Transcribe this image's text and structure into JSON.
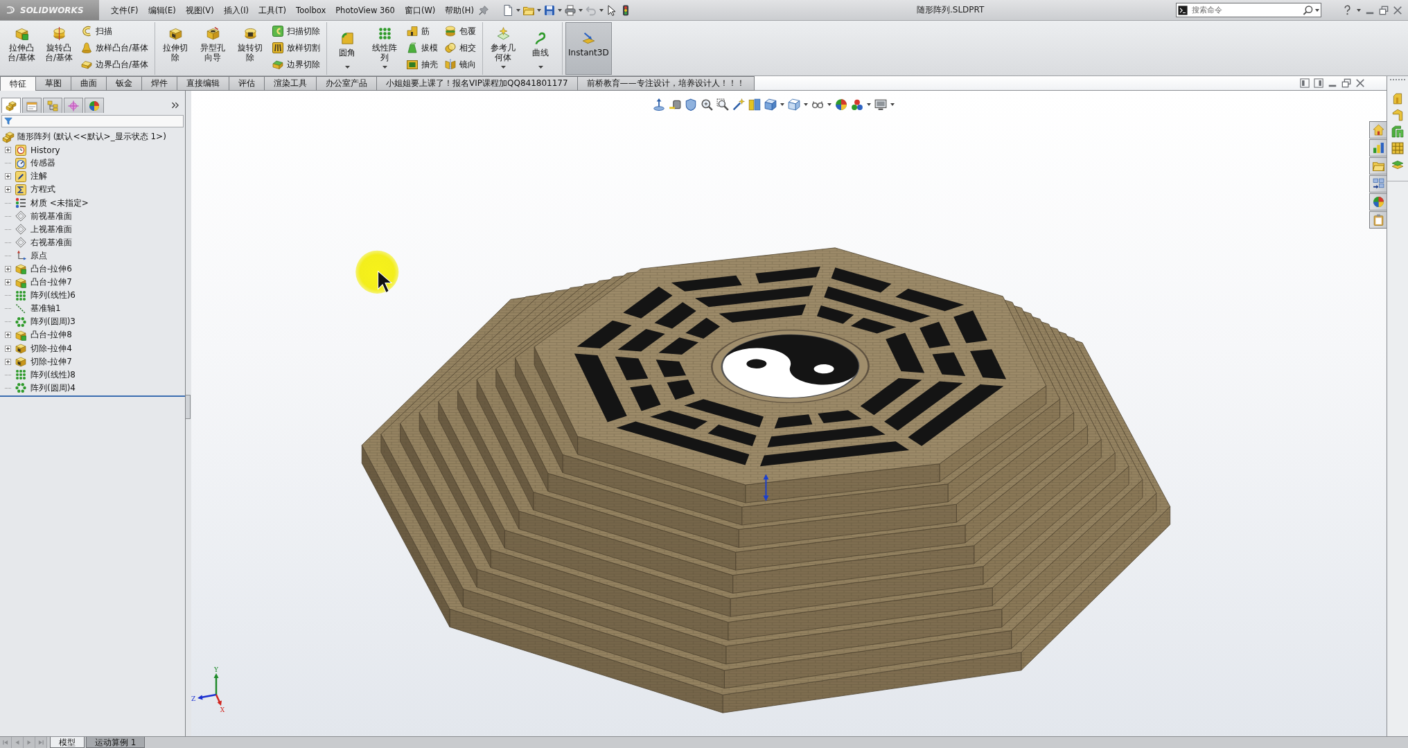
{
  "menu_bar": {
    "logo": "SOLIDWORKS",
    "menu": [
      "文件(F)",
      "编辑(E)",
      "视图(V)",
      "插入(I)",
      "工具(T)",
      "Toolbox",
      "PhotoView 360",
      "窗口(W)",
      "帮助(H)"
    ],
    "document_title": "随形阵列.SLDPRT",
    "search": {
      "placeholder": "搜索命令"
    }
  },
  "ribbon": [
    {
      "buttons": [
        {
          "kind": "large",
          "label": "拉伸凸台/基体",
          "has_menu": false,
          "on": false
        },
        {
          "kind": "large",
          "label": "旋转凸台/基体",
          "has_menu": false,
          "on": false
        },
        {
          "kind": "stack",
          "items": [
            "扫描",
            "放样凸台/基体",
            "边界凸台/基体"
          ]
        }
      ]
    },
    {
      "buttons": [
        {
          "kind": "large",
          "label": "拉伸切除",
          "has_menu": false,
          "on": false
        },
        {
          "kind": "large",
          "label": "异型孔向导",
          "has_menu": false,
          "on": false
        },
        {
          "kind": "large",
          "label": "旋转切除",
          "has_menu": false,
          "on": false
        },
        {
          "kind": "stack",
          "items": [
            "扫描切除",
            "放样切割",
            "边界切除"
          ]
        }
      ]
    },
    {
      "buttons": [
        {
          "kind": "large",
          "label": "圆角",
          "has_menu": true,
          "on": false
        },
        {
          "kind": "large",
          "label": "线性阵列",
          "has_menu": true,
          "on": false
        },
        {
          "kind": "stack",
          "items": [
            "筋",
            "拔模",
            "抽壳"
          ]
        },
        {
          "kind": "stack",
          "items": [
            "包覆",
            "相交",
            "镜向"
          ]
        }
      ]
    },
    {
      "buttons": [
        {
          "kind": "large",
          "label": "参考几何体",
          "has_menu": true,
          "on": false
        },
        {
          "kind": "large",
          "label": "曲线",
          "has_menu": true,
          "on": false
        }
      ]
    },
    {
      "buttons": [
        {
          "kind": "large",
          "label": "Instant3D",
          "has_menu": false,
          "on": true
        }
      ]
    }
  ],
  "command_tabs": [
    {
      "label": "特征",
      "selected": true
    },
    {
      "label": "草图",
      "selected": false
    },
    {
      "label": "曲面",
      "selected": false
    },
    {
      "label": "钣金",
      "selected": false
    },
    {
      "label": "焊件",
      "selected": false
    },
    {
      "label": "直接编辑",
      "selected": false
    },
    {
      "label": "评估",
      "selected": false
    },
    {
      "label": "渲染工具",
      "selected": false
    },
    {
      "label": "办公室产品",
      "selected": false
    },
    {
      "label": "小姐姐要上课了！报名VIP课程加QQ841801177",
      "selected": false
    },
    {
      "label": "前桥教育——专注设计，培养设计人！！！",
      "selected": false
    }
  ],
  "feature_manager_tabs": [
    {
      "selected": true
    },
    {
      "selected": false
    },
    {
      "selected": false
    },
    {
      "selected": false
    },
    {
      "selected": false
    }
  ],
  "feature_tree": {
    "root": "随形阵列 (默认<<默认>_显示状态 1>)",
    "items": [
      {
        "kind": "history",
        "label": "History",
        "expandable": true
      },
      {
        "kind": "sensor",
        "label": "传感器",
        "expandable": false
      },
      {
        "kind": "annotation",
        "label": "注解",
        "expandable": true
      },
      {
        "kind": "equation",
        "label": "方程式",
        "expandable": true
      },
      {
        "kind": "material",
        "label": "材质 <未指定>",
        "expandable": false
      },
      {
        "kind": "plane",
        "label": "前视基准面",
        "expandable": false
      },
      {
        "kind": "plane",
        "label": "上视基准面",
        "expandable": false
      },
      {
        "kind": "plane",
        "label": "右视基准面",
        "expandable": false
      },
      {
        "kind": "origin",
        "label": "原点",
        "expandable": false
      },
      {
        "kind": "boss",
        "label": "凸台-拉伸6",
        "expandable": true
      },
      {
        "kind": "boss",
        "label": "凸台-拉伸7",
        "expandable": true
      },
      {
        "kind": "linear",
        "label": "阵列(线性)6",
        "expandable": false
      },
      {
        "kind": "axis",
        "label": "基准轴1",
        "expandable": false
      },
      {
        "kind": "circular",
        "label": "阵列(圆周)3",
        "expandable": false
      },
      {
        "kind": "boss",
        "label": "凸台-拉伸8",
        "expandable": true
      },
      {
        "kind": "cut",
        "label": "切除-拉伸4",
        "expandable": true
      },
      {
        "kind": "cut",
        "label": "切除-拉伸7",
        "expandable": true
      },
      {
        "kind": "linear",
        "label": "阵列(线性)8",
        "expandable": false
      },
      {
        "kind": "circular",
        "label": "阵列(圆周)4",
        "expandable": false
      }
    ]
  },
  "viewport": {
    "triad_labels": [
      "Y",
      "Z",
      "X"
    ]
  },
  "bottom_tabs": [
    {
      "label": "模型",
      "selected": true
    },
    {
      "label": "运动算例 1",
      "selected": false
    }
  ]
}
